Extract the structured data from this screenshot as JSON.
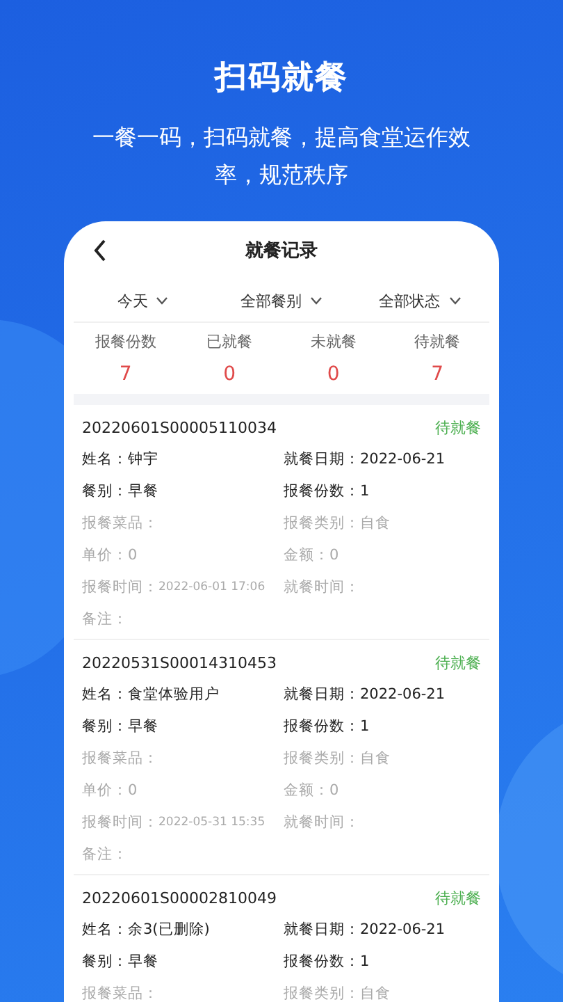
{
  "headline": "扫码就餐",
  "subtitle": "一餐一码，扫码就餐，提高食堂运作效率，规范秩序",
  "screen": {
    "title": "就餐记录",
    "filters": [
      {
        "label": "今天"
      },
      {
        "label": "全部餐别"
      },
      {
        "label": "全部状态"
      }
    ],
    "stats": [
      {
        "label": "报餐份数",
        "value": "7"
      },
      {
        "label": "已就餐",
        "value": "0"
      },
      {
        "label": "未就餐",
        "value": "0"
      },
      {
        "label": "待就餐",
        "value": "7"
      }
    ],
    "records": [
      {
        "number": "20220601S00005110034",
        "status": "待就餐",
        "fields": [
          {
            "label": "姓名：",
            "value": "钟宇",
            "kind": "main"
          },
          {
            "label": "就餐日期：",
            "value": "2022-06-21",
            "kind": "main"
          },
          {
            "label": "餐别：",
            "value": "早餐",
            "kind": "main"
          },
          {
            "label": "报餐份数：",
            "value": "1",
            "kind": "main"
          },
          {
            "label": "报餐菜品：",
            "kind": "muted"
          },
          {
            "label": "报餐类别：",
            "value": "自食",
            "kind": "muted"
          },
          {
            "label": "单价：",
            "value": "0",
            "kind": "muted"
          },
          {
            "label": "金额：",
            "value": "0",
            "kind": "muted"
          },
          {
            "label": "报餐时间：",
            "value": "2022-06-01 17:06",
            "kind": "time"
          },
          {
            "label": "就餐时间：",
            "kind": "muted"
          },
          {
            "label": "备注：",
            "kind": "muted"
          }
        ]
      },
      {
        "number": "20220531S00014310453",
        "status": "待就餐",
        "fields": [
          {
            "label": "姓名：",
            "value": "食堂体验用户",
            "kind": "main"
          },
          {
            "label": "就餐日期：",
            "value": "2022-06-21",
            "kind": "main"
          },
          {
            "label": "餐别：",
            "value": "早餐",
            "kind": "main"
          },
          {
            "label": "报餐份数：",
            "value": "1",
            "kind": "main"
          },
          {
            "label": "报餐菜品：",
            "kind": "muted"
          },
          {
            "label": "报餐类别：",
            "value": "自食",
            "kind": "muted"
          },
          {
            "label": "单价：",
            "value": "0",
            "kind": "muted"
          },
          {
            "label": "金额：",
            "value": "0",
            "kind": "muted"
          },
          {
            "label": "报餐时间：",
            "value": "2022-05-31 15:35",
            "kind": "time"
          },
          {
            "label": "就餐时间：",
            "kind": "muted"
          },
          {
            "label": "备注：",
            "kind": "muted"
          }
        ]
      },
      {
        "number": "20220601S00002810049",
        "status": "待就餐",
        "fields": [
          {
            "label": "姓名：",
            "value": "余3(已删除)",
            "kind": "main"
          },
          {
            "label": "就餐日期：",
            "value": "2022-06-21",
            "kind": "main"
          },
          {
            "label": "餐别：",
            "value": "早餐",
            "kind": "main"
          },
          {
            "label": "报餐份数：",
            "value": "1",
            "kind": "main"
          },
          {
            "label": "报餐菜品：",
            "kind": "muted"
          },
          {
            "label": "报餐类别：",
            "value": "自食",
            "kind": "muted"
          }
        ]
      }
    ]
  }
}
